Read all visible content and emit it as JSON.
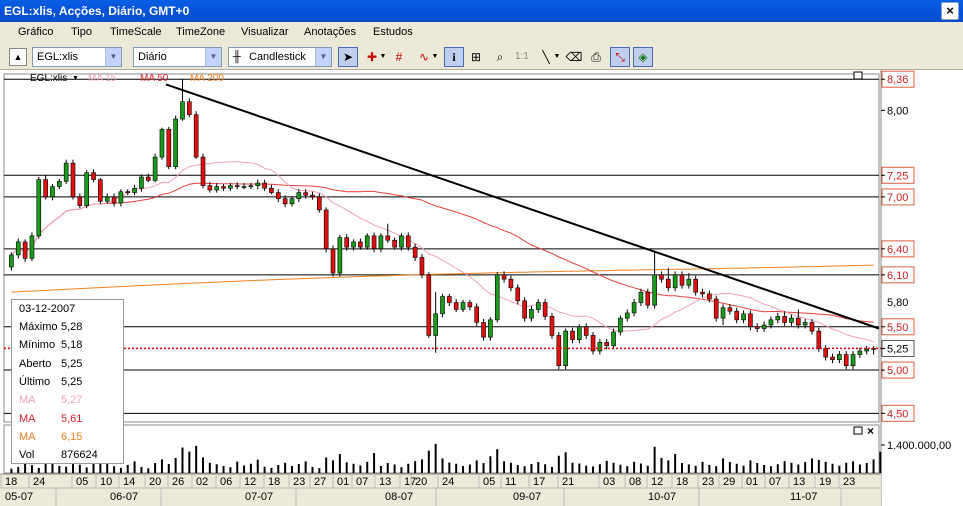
{
  "window": {
    "title": "EGL:xlis, Acções, Diário, GMT+0",
    "close": "×"
  },
  "menu": [
    "Gráfico",
    "Tipo",
    "TimeScale",
    "TimeZone",
    "Visualizar",
    "Anotações",
    "Estudos"
  ],
  "toolbar": {
    "symbol": "EGL:xlis",
    "period": "Diário",
    "chart_type": "Candlestick",
    "ratio_label": "1:1"
  },
  "legend": {
    "symbol": "EGL:xlis",
    "ma15": "MA 15",
    "ma50": "MA 50",
    "ma200": "MA 200"
  },
  "price_axis": [
    "8,36",
    "8,00",
    "7,25",
    "7,00",
    "6,40",
    "6,10",
    "5,50",
    "5,25",
    "5,00",
    "4,50"
  ],
  "price_axis_partial": "5,80",
  "volume_axis": "1.400.000,00",
  "colors": {
    "ma15": "#f4a0b6",
    "ma50": "#e84040",
    "ma200": "#f08020",
    "last_price_line": "#ee0000",
    "trendline": "#000000"
  },
  "info": {
    "date": "03-12-2007",
    "rows": [
      {
        "label": "Máximo",
        "value": "5,28",
        "color": "#000000"
      },
      {
        "label": "Mínimo",
        "value": "5,18",
        "color": "#000000"
      },
      {
        "label": "Aberto",
        "value": "5,25",
        "color": "#000000"
      },
      {
        "label": "Último",
        "value": "5,25",
        "color": "#000000"
      },
      {
        "label": "MA",
        "value": "5,27",
        "color": "#f4a0b6"
      },
      {
        "label": "MA",
        "value": "5,61",
        "color": "#e0202c"
      },
      {
        "label": "MA",
        "value": "6,15",
        "color": "#f08020"
      },
      {
        "label": "Vol",
        "value": "876624",
        "color": "#000000"
      }
    ]
  },
  "time_axis": {
    "days": [
      "18",
      "24",
      "05",
      "10",
      "14",
      "20",
      "26",
      "02",
      "06",
      "12",
      "18",
      "23",
      "27",
      "01",
      "07",
      "13",
      "17",
      "20",
      "24",
      "05",
      "11",
      "17",
      "21",
      "03",
      "08",
      "12",
      "18",
      "23",
      "29",
      "01",
      "07",
      "13",
      "19",
      "23"
    ],
    "months": [
      "05-07",
      "06-07",
      "07-07",
      "08-07",
      "09-07",
      "10-07",
      "11-07"
    ]
  },
  "chart_data": {
    "type": "candlestick",
    "ylim": [
      4.4,
      8.42
    ],
    "horizontal_lines": [
      8.36,
      7.25,
      7.0,
      6.4,
      6.1,
      5.5,
      5.0,
      4.5
    ],
    "last_price": 5.25,
    "trendline": {
      "from": 8.3,
      "to": 5.48
    },
    "candles": [
      [
        6.19,
        6.33,
        6.15,
        6.36
      ],
      [
        6.33,
        6.48,
        6.29,
        6.52
      ],
      [
        6.48,
        6.29,
        6.25,
        6.51
      ],
      [
        6.29,
        6.55,
        6.26,
        6.59
      ],
      [
        6.55,
        7.2,
        6.52,
        7.23
      ],
      [
        7.2,
        7.0,
        6.97,
        7.25
      ],
      [
        7.0,
        7.12,
        6.96,
        7.15
      ],
      [
        7.12,
        7.18,
        7.09,
        7.21
      ],
      [
        7.18,
        7.39,
        7.15,
        7.43
      ],
      [
        7.39,
        7.0,
        6.97,
        7.43
      ],
      [
        7.0,
        6.9,
        6.87,
        7.04
      ],
      [
        6.9,
        7.28,
        6.87,
        7.31
      ],
      [
        7.28,
        7.2,
        7.17,
        7.32
      ],
      [
        7.2,
        6.95,
        6.92,
        7.22
      ],
      [
        6.95,
        7.0,
        6.92,
        7.04
      ],
      [
        7.0,
        6.93,
        6.89,
        7.04
      ],
      [
        6.93,
        7.06,
        6.89,
        7.09
      ],
      [
        7.06,
        7.05,
        7.02,
        7.09
      ],
      [
        7.05,
        7.1,
        7.02,
        7.14
      ],
      [
        7.1,
        7.23,
        7.06,
        7.26
      ],
      [
        7.23,
        7.19,
        7.17,
        7.27
      ],
      [
        7.19,
        7.46,
        7.17,
        7.5
      ],
      [
        7.46,
        7.78,
        7.43,
        7.8
      ],
      [
        7.78,
        7.35,
        7.32,
        7.81
      ],
      [
        7.35,
        7.9,
        7.32,
        7.94
      ],
      [
        7.9,
        8.1,
        7.88,
        8.36
      ],
      [
        8.1,
        7.95,
        7.92,
        8.14
      ],
      [
        7.95,
        7.46,
        7.44,
        7.99
      ],
      [
        7.46,
        7.13,
        7.1,
        7.5
      ],
      [
        7.13,
        7.08,
        7.05,
        7.17
      ],
      [
        7.08,
        7.12,
        7.05,
        7.16
      ],
      [
        7.12,
        7.1,
        7.07,
        7.15
      ],
      [
        7.1,
        7.13,
        7.07,
        7.16
      ],
      [
        7.13,
        7.12,
        7.09,
        7.17
      ],
      [
        7.12,
        7.12,
        7.09,
        7.16
      ],
      [
        7.12,
        7.13,
        7.09,
        7.16
      ],
      [
        7.13,
        7.16,
        7.09,
        7.2
      ],
      [
        7.16,
        7.1,
        7.07,
        7.2
      ],
      [
        7.1,
        7.05,
        7.03,
        7.14
      ],
      [
        7.05,
        6.98,
        6.94,
        7.09
      ],
      [
        6.98,
        6.92,
        6.88,
        7.02
      ],
      [
        6.92,
        6.98,
        6.89,
        7.01
      ],
      [
        6.98,
        7.05,
        6.94,
        7.09
      ],
      [
        7.05,
        7.02,
        6.98,
        7.09
      ],
      [
        7.02,
        7.0,
        6.97,
        7.06
      ],
      [
        7.0,
        6.85,
        6.82,
        7.04
      ],
      [
        6.85,
        6.4,
        6.36,
        6.88
      ],
      [
        6.4,
        6.12,
        6.08,
        6.44
      ],
      [
        6.12,
        6.53,
        6.08,
        6.56
      ],
      [
        6.53,
        6.42,
        6.38,
        6.57
      ],
      [
        6.42,
        6.48,
        6.38,
        6.51
      ],
      [
        6.48,
        6.42,
        6.39,
        6.52
      ],
      [
        6.42,
        6.55,
        6.39,
        6.58
      ],
      [
        6.55,
        6.4,
        6.36,
        6.59
      ],
      [
        6.4,
        6.55,
        6.36,
        6.58
      ],
      [
        6.55,
        6.5,
        6.47,
        6.69
      ],
      [
        6.5,
        6.42,
        6.39,
        6.53
      ],
      [
        6.42,
        6.55,
        6.38,
        6.58
      ],
      [
        6.55,
        6.42,
        6.38,
        6.59
      ],
      [
        6.42,
        6.3,
        6.26,
        6.46
      ],
      [
        6.3,
        6.1,
        6.06,
        6.34
      ],
      [
        6.1,
        5.4,
        5.37,
        6.13
      ],
      [
        5.4,
        5.65,
        5.2,
        5.9
      ],
      [
        5.65,
        5.85,
        5.61,
        5.88
      ],
      [
        5.85,
        5.78,
        5.74,
        5.88
      ],
      [
        5.78,
        5.7,
        5.67,
        5.82
      ],
      [
        5.7,
        5.78,
        5.67,
        5.81
      ],
      [
        5.78,
        5.73,
        5.69,
        5.81
      ],
      [
        5.73,
        5.55,
        5.51,
        5.77
      ],
      [
        5.55,
        5.38,
        5.34,
        5.59
      ],
      [
        5.38,
        5.58,
        5.34,
        5.61
      ],
      [
        5.58,
        6.1,
        5.55,
        6.13
      ],
      [
        6.1,
        6.05,
        6.01,
        6.14
      ],
      [
        6.05,
        5.95,
        5.91,
        6.09
      ],
      [
        5.95,
        5.8,
        5.76,
        5.99
      ],
      [
        5.8,
        5.6,
        5.56,
        5.84
      ],
      [
        5.6,
        5.7,
        5.56,
        5.74
      ],
      [
        5.7,
        5.78,
        5.66,
        5.82
      ],
      [
        5.78,
        5.62,
        5.58,
        5.82
      ],
      [
        5.62,
        5.4,
        5.36,
        5.66
      ],
      [
        5.4,
        5.05,
        5.01,
        5.44
      ],
      [
        5.05,
        5.45,
        5.01,
        5.48
      ],
      [
        5.45,
        5.35,
        5.31,
        5.49
      ],
      [
        5.35,
        5.5,
        5.31,
        5.53
      ],
      [
        5.5,
        5.4,
        5.36,
        5.54
      ],
      [
        5.4,
        5.22,
        5.18,
        5.44
      ],
      [
        5.22,
        5.32,
        5.18,
        5.36
      ],
      [
        5.32,
        5.28,
        5.24,
        5.36
      ],
      [
        5.28,
        5.44,
        5.24,
        5.48
      ],
      [
        5.44,
        5.6,
        5.4,
        5.63
      ],
      [
        5.6,
        5.66,
        5.56,
        5.7
      ],
      [
        5.66,
        5.78,
        5.62,
        5.82
      ],
      [
        5.78,
        5.9,
        5.74,
        5.94
      ],
      [
        5.9,
        5.75,
        5.71,
        5.94
      ],
      [
        5.75,
        6.1,
        5.71,
        6.38
      ],
      [
        6.1,
        6.05,
        6.01,
        6.14
      ],
      [
        6.05,
        5.95,
        5.91,
        6.18
      ],
      [
        5.95,
        6.1,
        5.91,
        6.14
      ],
      [
        6.1,
        5.98,
        5.94,
        6.14
      ],
      [
        5.98,
        6.05,
        5.94,
        6.12
      ],
      [
        6.05,
        5.9,
        5.86,
        6.09
      ],
      [
        5.9,
        5.88,
        5.84,
        5.94
      ],
      [
        5.88,
        5.82,
        5.78,
        5.92
      ],
      [
        5.82,
        5.6,
        5.56,
        5.86
      ],
      [
        5.6,
        5.72,
        5.52,
        5.76
      ],
      [
        5.72,
        5.68,
        5.64,
        5.76
      ],
      [
        5.68,
        5.58,
        5.54,
        5.72
      ],
      [
        5.58,
        5.65,
        5.54,
        5.69
      ],
      [
        5.65,
        5.5,
        5.46,
        5.69
      ],
      [
        5.5,
        5.48,
        5.44,
        5.54
      ],
      [
        5.48,
        5.52,
        5.44,
        5.56
      ],
      [
        5.52,
        5.58,
        5.48,
        5.62
      ],
      [
        5.58,
        5.62,
        5.54,
        5.66
      ],
      [
        5.62,
        5.55,
        5.51,
        5.68
      ],
      [
        5.55,
        5.6,
        5.51,
        5.64
      ],
      [
        5.6,
        5.52,
        5.48,
        5.7
      ],
      [
        5.52,
        5.55,
        5.48,
        5.59
      ],
      [
        5.55,
        5.45,
        5.41,
        5.59
      ],
      [
        5.45,
        5.25,
        5.21,
        5.49
      ],
      [
        5.25,
        5.15,
        5.11,
        5.29
      ],
      [
        5.15,
        5.12,
        5.08,
        5.19
      ],
      [
        5.12,
        5.18,
        5.08,
        5.22
      ],
      [
        5.18,
        5.05,
        5.01,
        5.22
      ],
      [
        5.05,
        5.18,
        5.01,
        5.22
      ],
      [
        5.18,
        5.22,
        5.14,
        5.26
      ],
      [
        5.22,
        5.24,
        5.18,
        5.28
      ],
      [
        5.25,
        5.25,
        5.18,
        5.28
      ]
    ],
    "volume": [
      180000,
      250000,
      480000,
      320000,
      210000,
      380000,
      520000,
      290000,
      260000,
      410000,
      340000,
      230000,
      450000,
      600000,
      370000,
      280000,
      210000,
      330000,
      480000,
      250000,
      190000,
      410000,
      560000,
      370000,
      620000,
      1050000,
      880000,
      1120000,
      640000,
      420000,
      360000,
      290000,
      240000,
      470000,
      310000,
      380000,
      550000,
      260000,
      210000,
      330000,
      420000,
      290000,
      370000,
      480000,
      250000,
      200000,
      640000,
      520000,
      780000,
      440000,
      380000,
      310000,
      460000,
      820000,
      290000,
      410000,
      350000,
      240000,
      380000,
      490000,
      560000,
      920000,
      1200000,
      600000,
      430000,
      380000,
      290000,
      350000,
      520000,
      410000,
      690000,
      980000,
      480000,
      420000,
      330000,
      280000,
      370000,
      450000,
      360000,
      250000,
      710000,
      850000,
      420000,
      390000,
      300000,
      270000,
      360000,
      500000,
      420000,
      340000,
      280000,
      460000,
      390000,
      300000,
      1080000,
      620000,
      520000,
      780000,
      410000,
      350000,
      300000,
      460000,
      330000,
      280000,
      600000,
      450000,
      380000,
      300000,
      520000,
      410000,
      330000,
      280000,
      360000,
      490000,
      420000,
      350000,
      450000,
      600000,
      540000,
      460000,
      380000,
      300000,
      420000,
      480000,
      350000,
      410000,
      560000,
      876624
    ]
  }
}
